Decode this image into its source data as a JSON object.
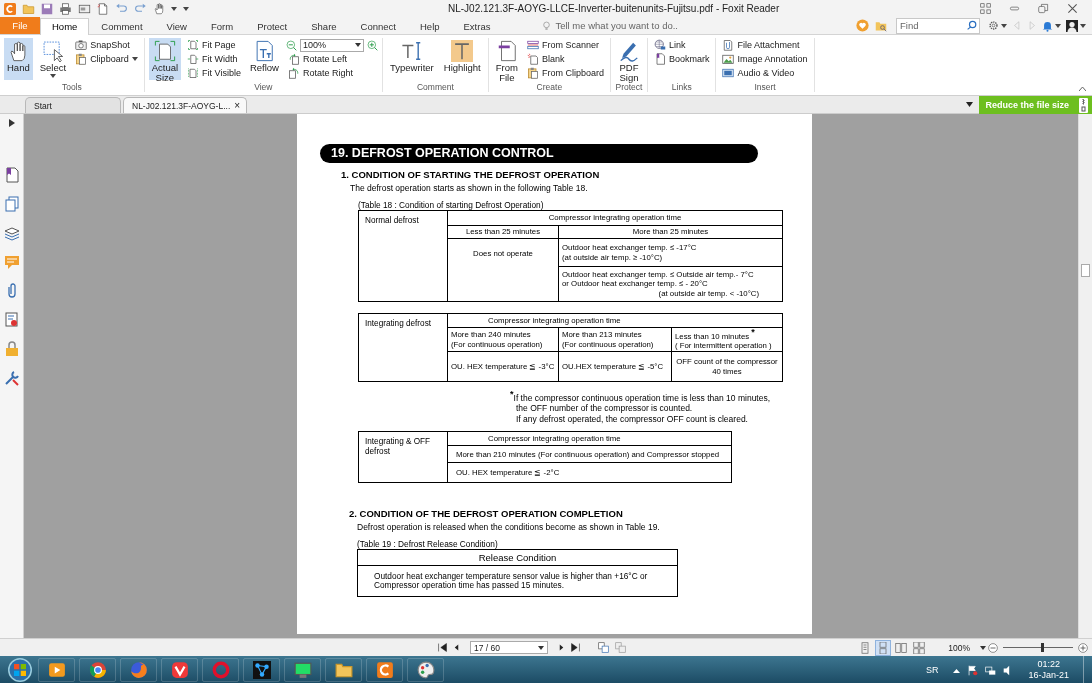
{
  "title_bar": {
    "title": "NL-J02.121.3F-AOYG-LLCE-Inverter-buitenunits-Fujitsu.pdf - Foxit Reader"
  },
  "menu_tabs": [
    {
      "label": "File",
      "kind": "file",
      "selected": false
    },
    {
      "label": "Home",
      "kind": "tab",
      "selected": true
    },
    {
      "label": "Comment",
      "kind": "tab",
      "selected": false
    },
    {
      "label": "View",
      "kind": "tab",
      "selected": false
    },
    {
      "label": "Form",
      "kind": "tab",
      "selected": false
    },
    {
      "label": "Protect",
      "kind": "tab",
      "selected": false
    },
    {
      "label": "Share",
      "kind": "tab",
      "selected": false
    },
    {
      "label": "Connect",
      "kind": "tab",
      "selected": false
    },
    {
      "label": "Help",
      "kind": "tab",
      "selected": false
    },
    {
      "label": "Extras",
      "kind": "tab",
      "selected": false
    }
  ],
  "tell_me": {
    "placeholder": "Tell me what you want to do.."
  },
  "find": {
    "placeholder": "Find"
  },
  "ribbon": {
    "groups": [
      {
        "label": "Tools",
        "items": [
          {
            "label": "Hand",
            "kind": "large",
            "selected": true
          },
          {
            "label": "Select",
            "kind": "large",
            "selected": false,
            "dropdown": true
          },
          {
            "label": "SnapShot",
            "kind": "small",
            "selected": false
          },
          {
            "label": "Clipboard",
            "kind": "small",
            "selected": false,
            "dropdown": true
          }
        ]
      },
      {
        "label": "View",
        "items": [
          {
            "label": "Actual\nSize",
            "kind": "large",
            "selected": true
          },
          {
            "label": "Fit Page",
            "kind": "small",
            "selected": false
          },
          {
            "label": "Fit Width",
            "kind": "small",
            "selected": false
          },
          {
            "label": "Fit Visible",
            "kind": "small",
            "selected": false
          },
          {
            "label": "Reflow",
            "kind": "large",
            "selected": false
          },
          {
            "kind": "zoom",
            "value": "100%"
          },
          {
            "label": "Rotate Left",
            "kind": "small",
            "selected": false
          },
          {
            "label": "Rotate Right",
            "kind": "small",
            "selected": false
          }
        ]
      },
      {
        "label": "Comment",
        "items": [
          {
            "label": "Typewriter",
            "kind": "large",
            "selected": false
          },
          {
            "label": "Highlight",
            "kind": "large",
            "selected": false
          }
        ]
      },
      {
        "label": "Create",
        "items": [
          {
            "label": "From\nFile",
            "kind": "large",
            "selected": false
          },
          {
            "label": "From Scanner",
            "kind": "small",
            "selected": false
          },
          {
            "label": "Blank",
            "kind": "small",
            "selected": false
          },
          {
            "label": "From Clipboard",
            "kind": "small",
            "selected": false
          }
        ]
      },
      {
        "label": "Protect",
        "items": [
          {
            "label": "PDF\nSign",
            "kind": "large",
            "selected": false
          }
        ]
      },
      {
        "label": "Links",
        "items": [
          {
            "label": "Link",
            "kind": "small",
            "selected": false
          },
          {
            "label": "Bookmark",
            "kind": "small",
            "selected": false
          }
        ]
      },
      {
        "label": "Insert",
        "items": [
          {
            "label": "File Attachment",
            "kind": "small",
            "selected": false
          },
          {
            "label": "Image Annotation",
            "kind": "small",
            "selected": false
          },
          {
            "label": "Audio & Video",
            "kind": "small",
            "selected": false
          }
        ]
      }
    ]
  },
  "doc_tabs": [
    {
      "label": "Start",
      "selected": false
    },
    {
      "label": "NL-J02.121.3F-AOYG-L...",
      "selected": true,
      "close": "×"
    }
  ],
  "reduce_button": {
    "label": "Reduce the file size"
  },
  "document": {
    "heading": "19.  DEFROST OPERATION CONTROL",
    "section_1": {
      "title": "1. CONDITION OF STARTING THE DEFROST OPERATION",
      "intro": "The defrost operation starts as shown in the following Table 18.",
      "table_18": {
        "caption": "(Table 18 : Condition of starting Defrost Operation)",
        "row_label": "Normal defrost",
        "header": "Compressor integrating operation time",
        "columns": [
          "Less than 25 minutes",
          "More than 25 minutes"
        ],
        "short_time": "Does not operate",
        "long_time": [
          "Outdoor heat exchanger temp. ≤ -17°C\n(at outside air temp. ≥ -10°C)",
          "Outdoor heat exchanger temp. ≤ Outside air temp.- 7°C\nor Outdoor heat exchanger temp. ≤ - 20°C"
        ],
        "long_time_note": "(at outside air temp. < -10°C)"
      },
      "table_integrating": {
        "row_label": "Integrating defrost",
        "header": "Compressor integrating operation time",
        "columns": [
          {
            "condition": "More than 240 minutes\n(For continuous operation)",
            "value": "OU. HEX temperature ≦ -3°C"
          },
          {
            "condition": "More than 213 minutes\n(For continuous operation)",
            "value": "OU.HEX temperature   ≦ -5°C"
          },
          {
            "condition": "Less than 10 minutes $^{*}$\n( For intermittent operation )",
            "value": "OFF count of the compressor\n40 times"
          }
        ]
      },
      "footnote": "$^{*}$If the compressor continuous operation time is less than 10 minutes,\nthe OFF number of the compressor is counted.\nIf any defrost operated, the compressor OFF count is cleared.",
      "table_integrating_off": {
        "row_label": "Integrating & OFF\n defrost",
        "header": "Compressor integrating operation time",
        "condition": "More than 210 minutes (For continuous operation)  and  Compressor stopped",
        "value": "OU. HEX temperature ≦ -2°C"
      }
    },
    "section_2": {
      "title": "2. CONDITION OF THE DEFROST OPERATION COMPLETION",
      "intro": "Defrost operation is released when the conditions become as shown in Table 19.",
      "table_19": {
        "caption": "(Table 19 : Defrost Release Condition)",
        "header": "Release Condition",
        "body": "Outdoor heat exchanger temperature sensor value is higher than +16°C or\nCompressor operation time has passed 15 minutes."
      }
    }
  },
  "status_bar": {
    "page": "17 / 60",
    "view_modes": [
      {
        "selected": false
      },
      {
        "selected": true
      },
      {
        "selected": false
      },
      {
        "selected": false
      }
    ],
    "zoom": "100%",
    "zoom_slider": {
      "level": 0.55
    }
  },
  "taskbar": {
    "language": "SR",
    "time": "01:22",
    "date": "16-Jan-21"
  }
}
